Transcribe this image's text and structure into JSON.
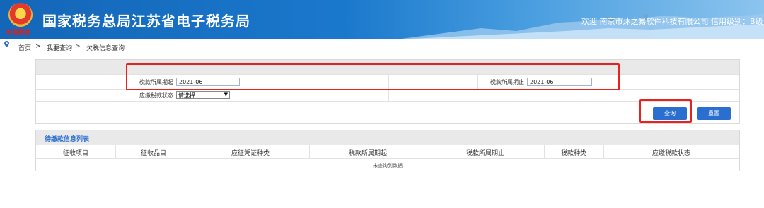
{
  "header": {
    "title": "国家税务总局江苏省电子税务局",
    "emblem_text": "中国税务",
    "welcome": "欢迎 南京市沐之易软件科技有限公司 信用级别：B级 | 关闭"
  },
  "breadcrumb": {
    "home": "首页",
    "sep1": ">",
    "level1": "我要查询",
    "sep2": ">",
    "current": "欠税信息查询"
  },
  "query": {
    "period_start_label": "税款所属期起",
    "period_start_value": "2021-06",
    "period_end_label": "税款所属期止",
    "period_end_value": "2021-06",
    "status_label": "应缴税款状态",
    "status_value": "请选择",
    "query_button": "查询",
    "reset_button": "重置"
  },
  "list": {
    "title": "待缴款信息列表",
    "columns": [
      "征收项目",
      "征收品目",
      "应征凭证种类",
      "税款所属期起",
      "税款所属期止",
      "税款种类",
      "应缴税款状态"
    ],
    "empty_text": "未查询到数据"
  },
  "colors": {
    "accent": "#2a6fd0",
    "highlight": "#e8231f",
    "header_blue": "#1466b8"
  },
  "icons": {
    "breadcrumb_pin": "location-pin-icon",
    "select_caret": "chevron-down-icon"
  }
}
